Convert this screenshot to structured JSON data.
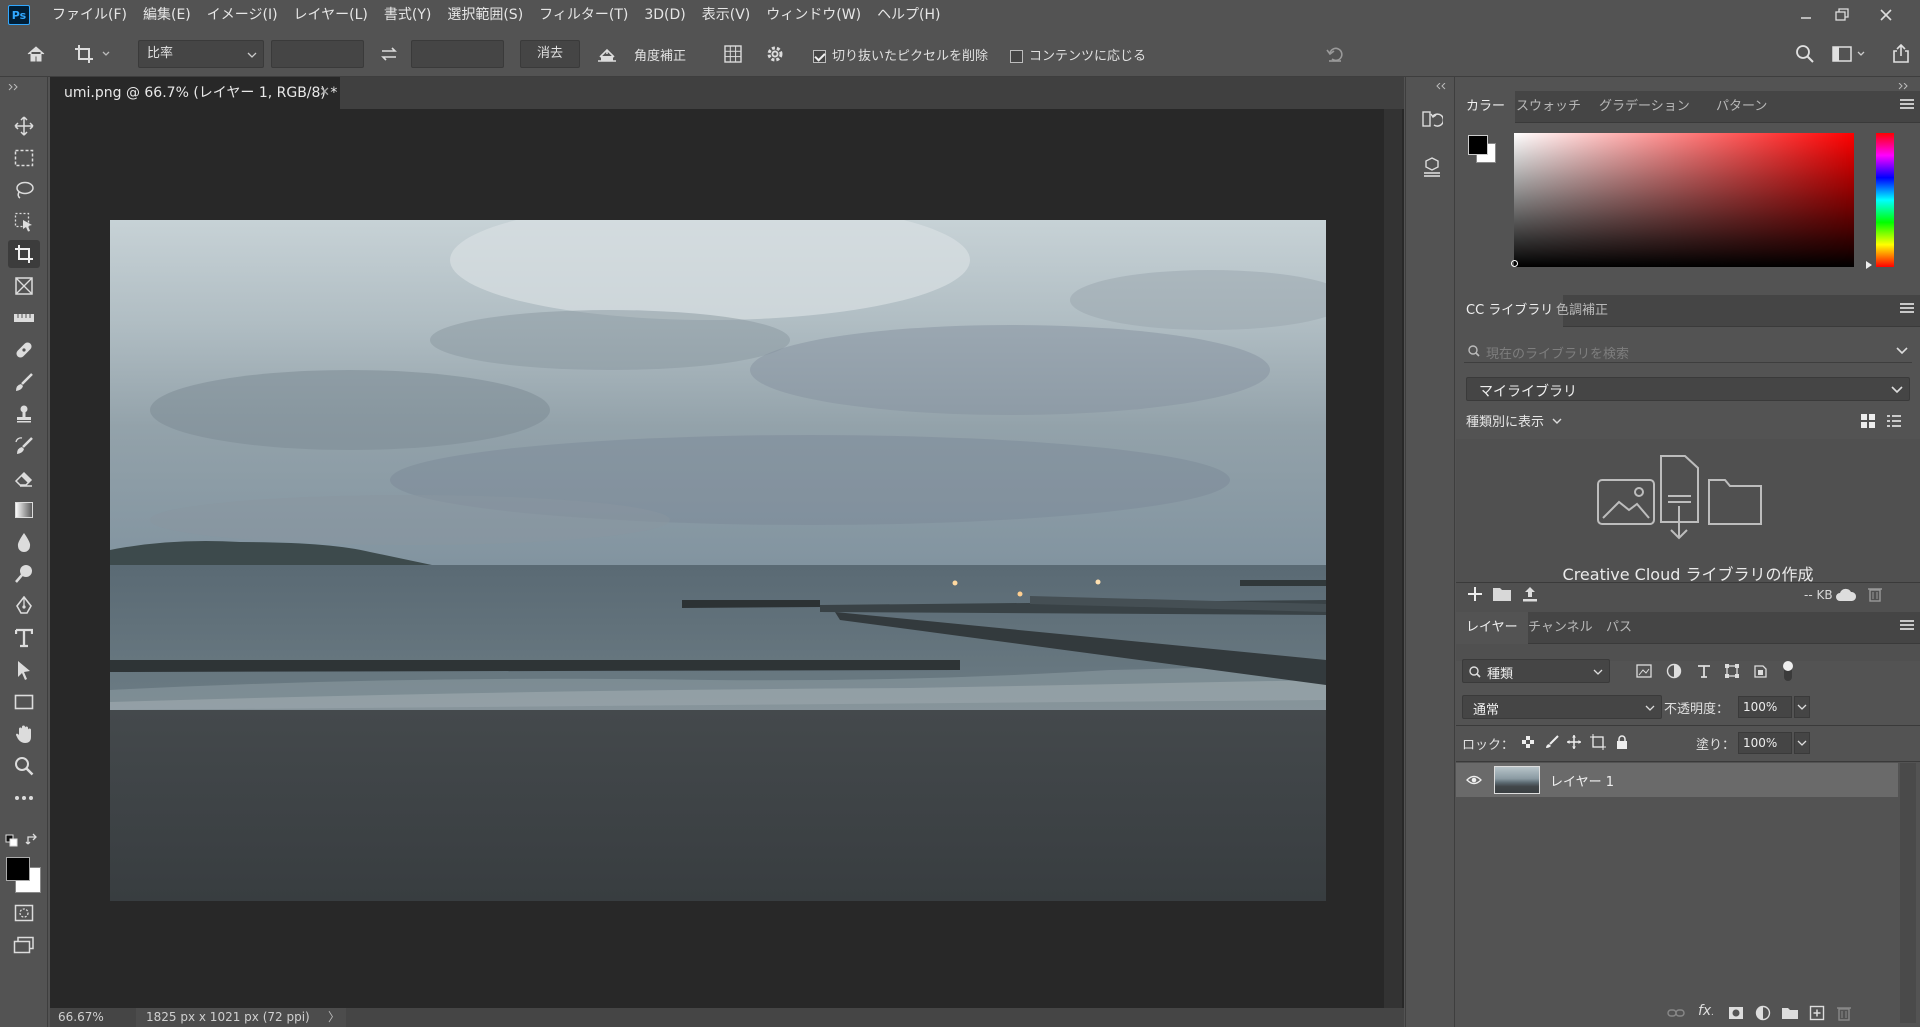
{
  "app": {
    "logo_text": "Ps"
  },
  "menu": [
    "ファイル(F)",
    "編集(E)",
    "イメージ(I)",
    "レイヤー(L)",
    "書式(Y)",
    "選択範囲(S)",
    "フィルター(T)",
    "3D(D)",
    "表示(V)",
    "ウィンドウ(W)",
    "ヘルプ(H)"
  ],
  "options": {
    "ratio_select": "比率",
    "width_value": "",
    "height_value": "",
    "clear_button": "消去",
    "straighten_label": "角度補正",
    "delete_cropped": {
      "label": "切り抜いたピクセルを削除",
      "checked": true
    },
    "content_aware": {
      "label": "コンテンツに応じる",
      "checked": false
    }
  },
  "document": {
    "tab_title": "umi.png @ 66.7% (レイヤー 1, RGB/8) *",
    "zoom": "66.67%",
    "doc_info": "1825 px x 1021 px (72 ppi)"
  },
  "panels": {
    "color": {
      "tabs": [
        "カラー",
        "スウォッチ",
        "グラデーション",
        "パターン"
      ],
      "foreground": "#000000",
      "background": "#ffffff",
      "hue_color": "#ff0000"
    },
    "library": {
      "tabs": [
        "CC ライブラリ",
        "色調補正"
      ],
      "search_placeholder": "現在のライブラリを検索",
      "library_select": "マイライブラリ",
      "view_by": "種類別に表示",
      "create_label": "Creative Cloud ライブラリの作成",
      "storage": "-- KB"
    },
    "layers": {
      "tabs": [
        "レイヤー",
        "チャンネル",
        "パス"
      ],
      "filter_kind": "種類",
      "blend_mode": "通常",
      "opacity_label": "不透明度：",
      "opacity_value": "100%",
      "lock_label": "ロック：",
      "fill_label": "塗り：",
      "fill_value": "100%",
      "layer_list": [
        {
          "name": "レイヤー 1",
          "visible": true
        }
      ]
    }
  }
}
